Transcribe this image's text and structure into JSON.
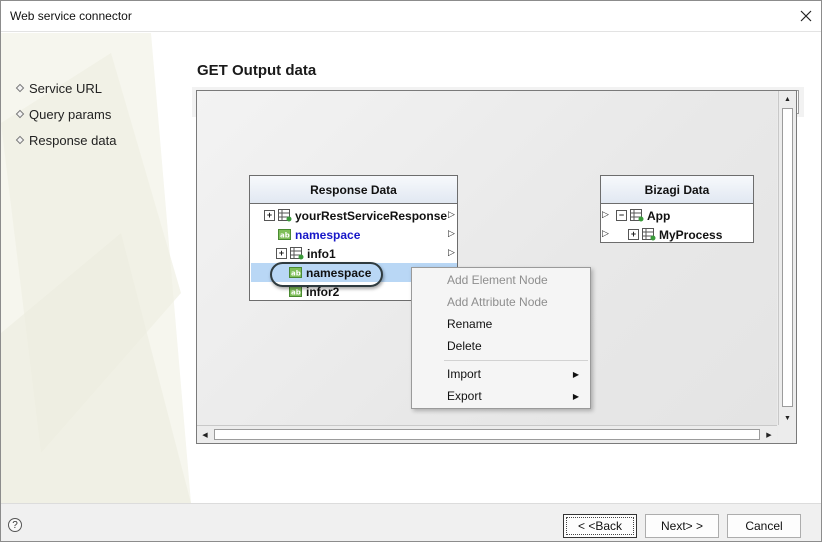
{
  "window": {
    "title": "Web service connector"
  },
  "nav": {
    "items": [
      {
        "label": "Service URL"
      },
      {
        "label": "Query params"
      },
      {
        "label": "Response data"
      }
    ]
  },
  "page": {
    "title": "GET Output data"
  },
  "toolbar": {
    "icons": [
      "auto-map-icon",
      "list-map-icon",
      "layout-icon"
    ]
  },
  "response_box": {
    "header": "Response Data",
    "rows": [
      {
        "label": "yourRestServiceResponse"
      },
      {
        "label": "namespace"
      },
      {
        "label": "info1"
      },
      {
        "label": "namespace"
      },
      {
        "label": "infor2"
      }
    ]
  },
  "bizagi_box": {
    "header": "Bizagi Data",
    "rows": [
      {
        "label": "App"
      },
      {
        "label": "MyProcess"
      }
    ]
  },
  "context_menu": {
    "items": [
      {
        "label": "Add Element Node",
        "enabled": false
      },
      {
        "label": "Add Attribute Node",
        "enabled": false
      },
      {
        "label": "Rename",
        "enabled": true
      },
      {
        "label": "Delete",
        "enabled": true
      },
      {
        "label": "Import",
        "enabled": true,
        "submenu": true
      },
      {
        "label": "Export",
        "enabled": true,
        "submenu": true
      }
    ]
  },
  "footer": {
    "back_label": "< <Back",
    "next_label": "Next> >",
    "cancel_label": "Cancel"
  },
  "colors": {
    "selection": "#b9d7f5",
    "header_gradient": "#e1e8f2",
    "blue_text": "#1717c8",
    "menu_bg": "#f5f5f5"
  }
}
